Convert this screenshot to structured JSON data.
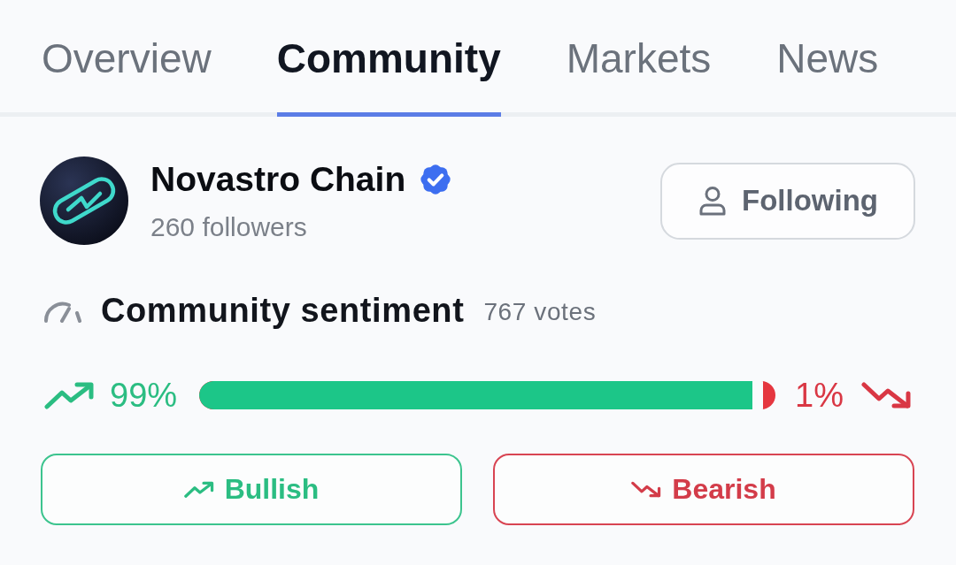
{
  "tabs": [
    {
      "label": "Overview",
      "selected": false
    },
    {
      "label": "Community",
      "selected": true
    },
    {
      "label": "Markets",
      "selected": false
    },
    {
      "label": "News",
      "selected": false
    }
  ],
  "project": {
    "name": "Novastro Chain",
    "verified": true,
    "followers": "260 followers",
    "follow_button": {
      "label": "Following"
    }
  },
  "sentiment": {
    "title": "Community sentiment",
    "votes": "767 votes",
    "bullish": {
      "reading": "99%",
      "level": 0.96
    },
    "bearish": {
      "reading": "1%"
    },
    "buttons": [
      {
        "label": "Bullish",
        "kind": "bullish"
      },
      {
        "label": "Bearish",
        "kind": "bearish"
      }
    ]
  }
}
